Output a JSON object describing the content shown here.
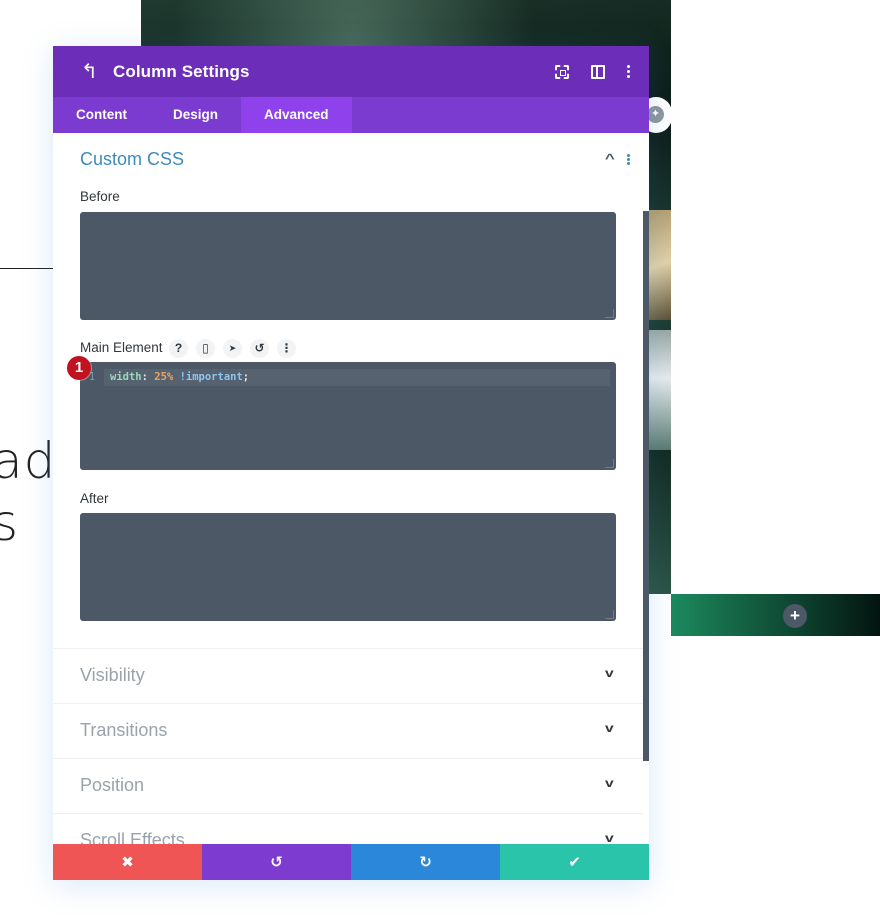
{
  "background": {
    "heading_fragment_1": "ad",
    "heading_fragment_2": "s",
    "add_row_icon": "plus-icon",
    "globe_icon": "globe-icon"
  },
  "modal": {
    "title": "Column Settings",
    "header_icons": [
      "back-arrow-icon",
      "expand-icon",
      "split-view-icon",
      "more-vertical-icon"
    ],
    "tabs": [
      {
        "label": "Content",
        "active": false
      },
      {
        "label": "Design",
        "active": false
      },
      {
        "label": "Advanced",
        "active": true
      }
    ],
    "section": {
      "title": "Custom CSS",
      "expanded": true,
      "fields": {
        "before": {
          "label": "Before",
          "value": ""
        },
        "main_element": {
          "label": "Main Element",
          "tools": [
            {
              "icon": "help-icon",
              "glyph": "?"
            },
            {
              "icon": "mobile-icon",
              "glyph": "▯"
            },
            {
              "icon": "cursor-icon",
              "glyph": "➤"
            },
            {
              "icon": "reset-icon",
              "glyph": "↺"
            },
            {
              "icon": "more-vertical-icon",
              "glyph": "⋮"
            }
          ],
          "badge": "1",
          "code": {
            "line_number": "1",
            "property": "width",
            "colon": ":",
            "value": "25%",
            "important": "!important",
            "semicolon": ";"
          }
        },
        "after": {
          "label": "After",
          "value": ""
        }
      }
    },
    "collapsed_sections": [
      {
        "title": "Visibility"
      },
      {
        "title": "Transitions"
      },
      {
        "title": "Position"
      },
      {
        "title": "Scroll Effects"
      }
    ],
    "footer": {
      "cancel": {
        "glyph": "✖",
        "icon": "close-icon"
      },
      "undo": {
        "glyph": "↺",
        "icon": "undo-icon"
      },
      "redo": {
        "glyph": "↻",
        "icon": "redo-icon"
      },
      "save": {
        "glyph": "✔",
        "icon": "check-icon"
      }
    },
    "colors": {
      "header": "#6c2eb9",
      "tabs": "#7b3bd0",
      "active_tab": "#8f42ec",
      "cancel": "#ef5555",
      "undo": "#7e3bd0",
      "redo": "#2b87da",
      "save": "#29c4a9",
      "code_bg": "#4c5866"
    }
  }
}
